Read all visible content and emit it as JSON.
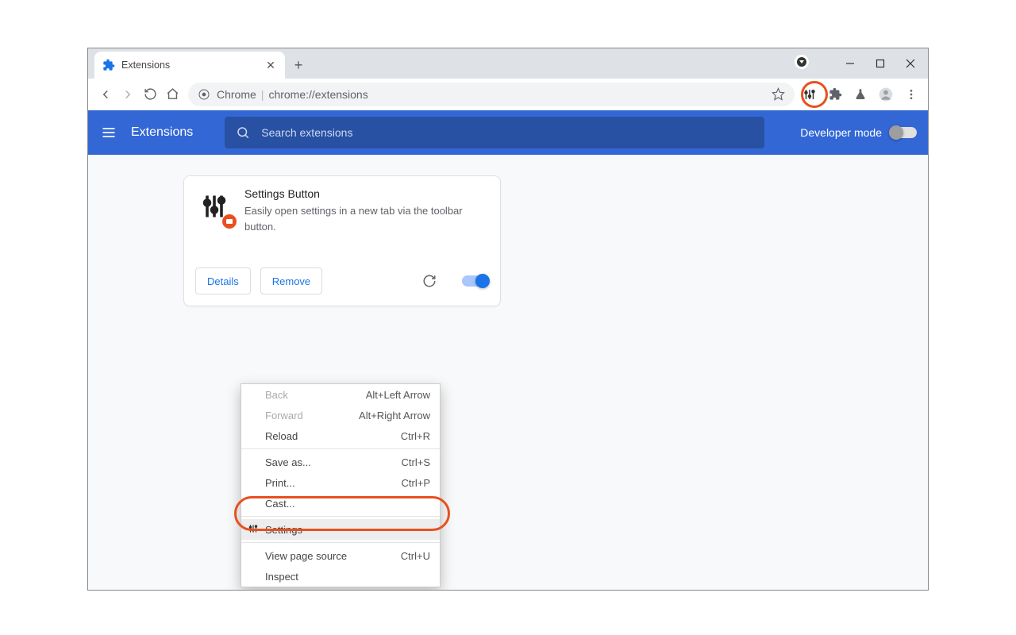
{
  "tab": {
    "title": "Extensions"
  },
  "address": {
    "scheme_label": "Chrome",
    "url_text": "chrome://extensions"
  },
  "blue_header": {
    "title": "Extensions",
    "search_placeholder": "Search extensions",
    "dev_mode_label": "Developer mode"
  },
  "extension_card": {
    "title": "Settings Button",
    "description": "Easily open settings in a new tab via the toolbar button.",
    "details_btn": "Details",
    "remove_btn": "Remove"
  },
  "context_menu": {
    "items": [
      {
        "label": "Back",
        "shortcut": "Alt+Left Arrow",
        "disabled": true
      },
      {
        "label": "Forward",
        "shortcut": "Alt+Right Arrow",
        "disabled": true
      },
      {
        "label": "Reload",
        "shortcut": "Ctrl+R"
      },
      {
        "sep": true
      },
      {
        "label": "Save as...",
        "shortcut": "Ctrl+S"
      },
      {
        "label": "Print...",
        "shortcut": "Ctrl+P"
      },
      {
        "label": "Cast..."
      },
      {
        "sep": true
      },
      {
        "label": "Settings",
        "icon": "sliders",
        "highlight": true
      },
      {
        "sep": true
      },
      {
        "label": "View page source",
        "shortcut": "Ctrl+U"
      },
      {
        "label": "Inspect"
      }
    ]
  }
}
